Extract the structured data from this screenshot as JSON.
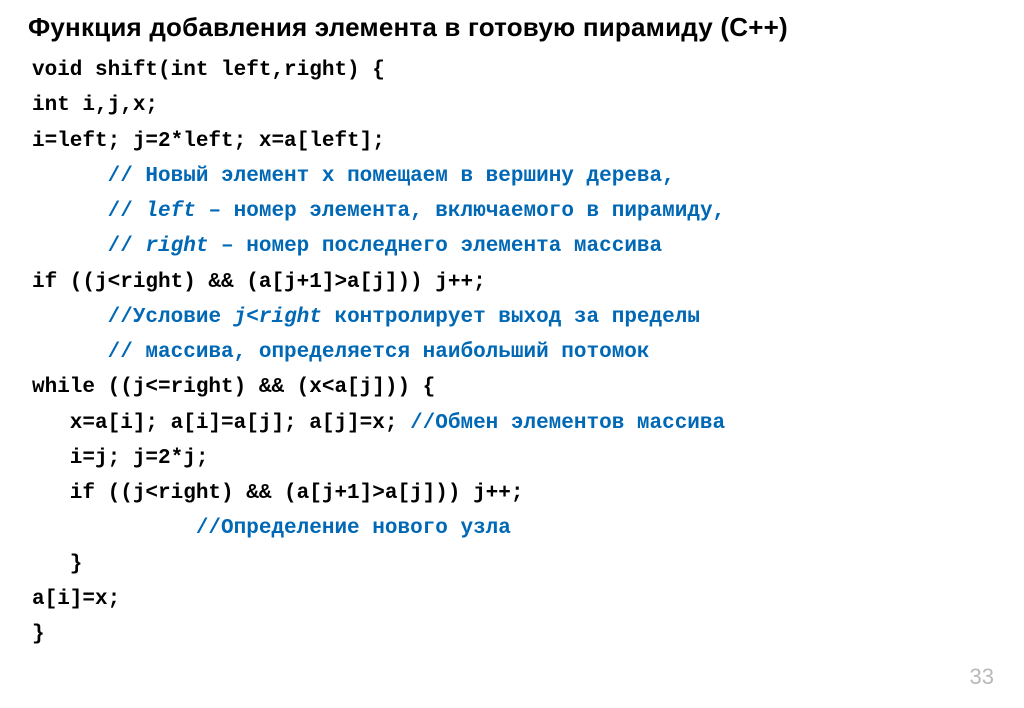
{
  "title": "Функция добавления элемента в готовую пирамиду (С++)",
  "page_number": "33",
  "code": {
    "l1": "void shift(int left,right) {",
    "l2": "int i,j,x;",
    "l3": "i=left; j=2*left; x=a[left];",
    "c1a": "// Новый элемент х помещаем в вершину дерева,",
    "c2a": "// ",
    "c2b": "left",
    "c2c": " – номер элемента, включаемого в пирамиду,",
    "c3a": "// ",
    "c3b": "right",
    "c3c": " – номер последнего элемента массива",
    "l4": "if ((j<right) && (a[j+1]>a[j])) j++;",
    "c4a": "//Условие ",
    "c4b": "j<right",
    "c4c": " контролирует выход за пределы",
    "c5": "// массива, определяется наибольший потомок",
    "l5": "while ((j<=right) && (x<a[j])) {",
    "l6a": "   x=a[i]; a[i]=a[j]; a[j]=x; ",
    "c6": "//Обмен элементов массива",
    "l7": "   i=j; j=2*j;",
    "l8": "   if ((j<right) && (a[j+1]>a[j])) j++;",
    "c7": "//Определение нового узла",
    "l9": "   }",
    "l10": "a[i]=x;",
    "l11": "}"
  }
}
